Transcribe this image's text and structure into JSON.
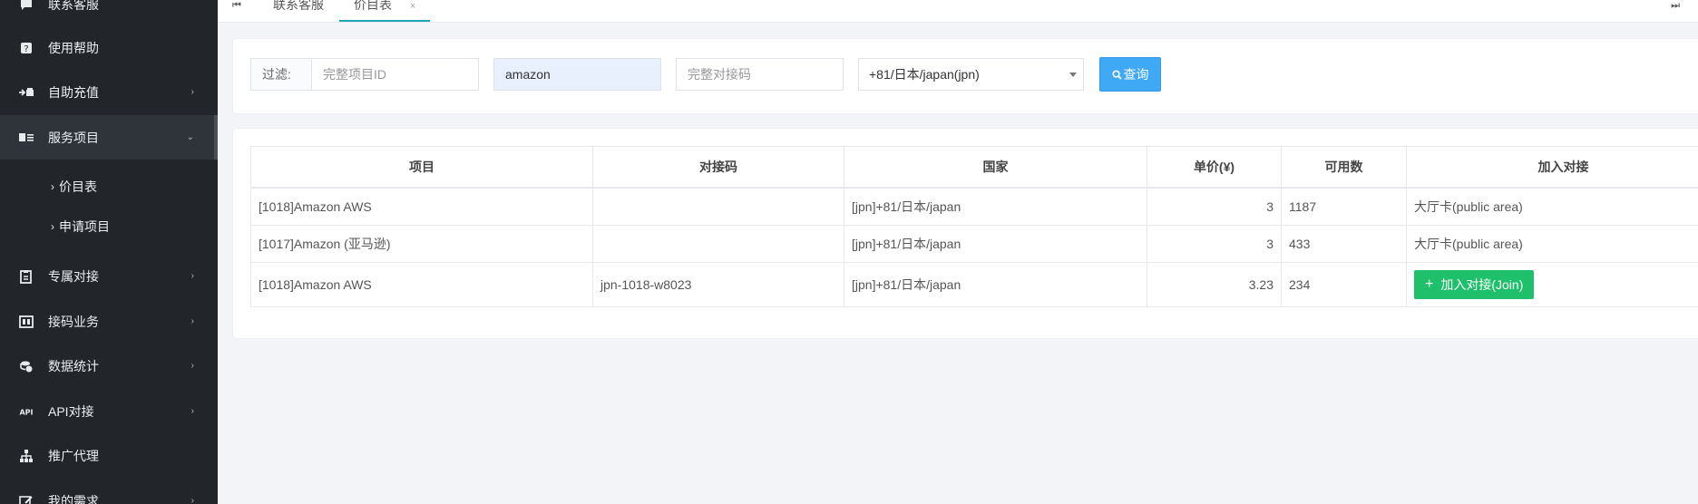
{
  "sidebar": {
    "items": [
      {
        "label": "联系客服",
        "icon": "chat-icon"
      },
      {
        "label": "使用帮助",
        "icon": "help-icon"
      },
      {
        "label": "自助充值",
        "icon": "recharge-icon"
      },
      {
        "label": "服务项目",
        "icon": "service-card-icon"
      },
      {
        "label": "专属对接",
        "icon": "clipboard-icon"
      },
      {
        "label": "接码业务",
        "icon": "sim-icon"
      },
      {
        "label": "数据统计",
        "icon": "coins-icon"
      },
      {
        "label": "API对接",
        "icon": "api-icon"
      },
      {
        "label": "推广代理",
        "icon": "sitemap-icon"
      },
      {
        "label": "我的需求",
        "icon": "edit-icon"
      }
    ],
    "subitems": [
      {
        "label": "价目表"
      },
      {
        "label": "申请项目"
      }
    ]
  },
  "tabs": {
    "items": [
      {
        "label": "联系客服"
      },
      {
        "label": "价目表",
        "close": "×"
      }
    ]
  },
  "filter": {
    "label": "过滤:",
    "project_id_placeholder": "完整项目ID",
    "keyword_value": "amazon",
    "code_placeholder": "完整对接码",
    "country_selected": "+81/日本/japan(jpn)",
    "query_label": "查询"
  },
  "table": {
    "headers": [
      "项目",
      "对接码",
      "国家",
      "单价(¥)",
      "可用数",
      "加入对接"
    ],
    "rows": [
      {
        "project": "[1018]Amazon AWS",
        "code": "",
        "country": "[jpn]+81/日本/japan",
        "price": "3",
        "available": "1187",
        "join": "大厅卡(public area)"
      },
      {
        "project": "[1017]Amazon (亚马逊)",
        "code": "",
        "country": "[jpn]+81/日本/japan",
        "price": "3",
        "available": "433",
        "join": "大厅卡(public area)"
      },
      {
        "project": "[1018]Amazon AWS",
        "code": "jpn-1018-w8023",
        "country": "[jpn]+81/日本/japan",
        "price": "3.23",
        "available": "234",
        "join_button": "加入对接(Join)"
      }
    ]
  },
  "colors": {
    "sidebar_bg": "#22262b",
    "query_button": "#3fa9f5",
    "join_button": "#1fc06b",
    "price_text": "#1a9a1a",
    "active_tab_underline": "#1ea7b8"
  }
}
